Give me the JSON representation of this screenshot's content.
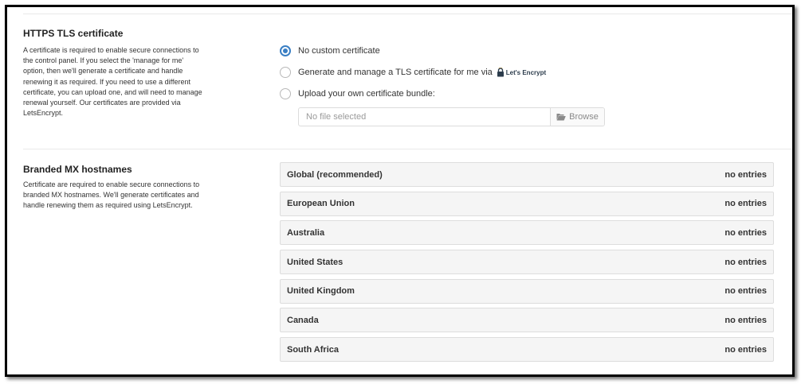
{
  "https": {
    "title": "HTTPS TLS certificate",
    "description": "A certificate is required to enable secure connections to the control panel. If you select the 'manage for me' option, then we'll generate a certificate and handle renewing it as required. If you need to use a different certificate, you can upload one, and will need to manage renewal yourself. Our certificates are provided via LetsEncrypt.",
    "options": [
      {
        "label": "No custom certificate",
        "checked": true
      },
      {
        "label": "Generate and manage a TLS certificate for me via",
        "logo_text": "Let's Encrypt",
        "checked": false
      },
      {
        "label": "Upload your own certificate bundle:",
        "checked": false
      }
    ],
    "file_placeholder": "No file selected",
    "browse_label": "Browse"
  },
  "mx": {
    "title": "Branded MX hostnames",
    "description": "Certificate are required to enable secure connections to branded MX hostnames. We'll generate certificates and handle renewing them as required using LetsEncrypt.",
    "regions": [
      {
        "name": "Global (recommended)",
        "status": "no entries"
      },
      {
        "name": "European Union",
        "status": "no entries"
      },
      {
        "name": "Australia",
        "status": "no entries"
      },
      {
        "name": "United States",
        "status": "no entries"
      },
      {
        "name": "United Kingdom",
        "status": "no entries"
      },
      {
        "name": "Canada",
        "status": "no entries"
      },
      {
        "name": "South Africa",
        "status": "no entries"
      }
    ]
  },
  "colors": {
    "accent": "#3a7fc4",
    "panel_bg": "#f5f5f5",
    "border": "#dddddd"
  },
  "icons": {
    "browse": "folder-open-icon",
    "letsencrypt": "padlock-icon"
  }
}
